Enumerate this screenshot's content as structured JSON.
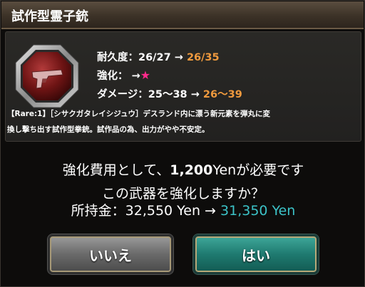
{
  "dialog": {
    "title": "試作型霊子銃"
  },
  "weapon": {
    "icon": "pistol-icon",
    "durability_label": "耐久度：",
    "durability_current": "26/27",
    "durability_new": "26/35",
    "enhance_label": "強化：",
    "enhance_new": "★",
    "damage_label": "ダメージ：",
    "damage_current": "25〜38",
    "damage_new": "26〜39",
    "arrow": "→",
    "description_line1": "【Rare:1】［シサクガタレイシジュウ］デスランド内に漂う新元素を弾丸に変",
    "description_line2": "換し撃ち出す試作型拳銃。試作品の為、出力がやや不安定。"
  },
  "confirm": {
    "cost_prefix": "強化費用として、",
    "cost_amount": "1,200",
    "cost_suffix": "Yenが必要です",
    "question": "この武器を強化しますか？",
    "money_label": "所持金：",
    "money_current": "32,550 Yen",
    "money_after": "31,350 Yen"
  },
  "buttons": {
    "no_label": "いいえ",
    "yes_label": "はい"
  },
  "colors": {
    "upgrade": "#f09a3e",
    "star": "#ff2a8c",
    "money_after": "#3cc3c8"
  }
}
